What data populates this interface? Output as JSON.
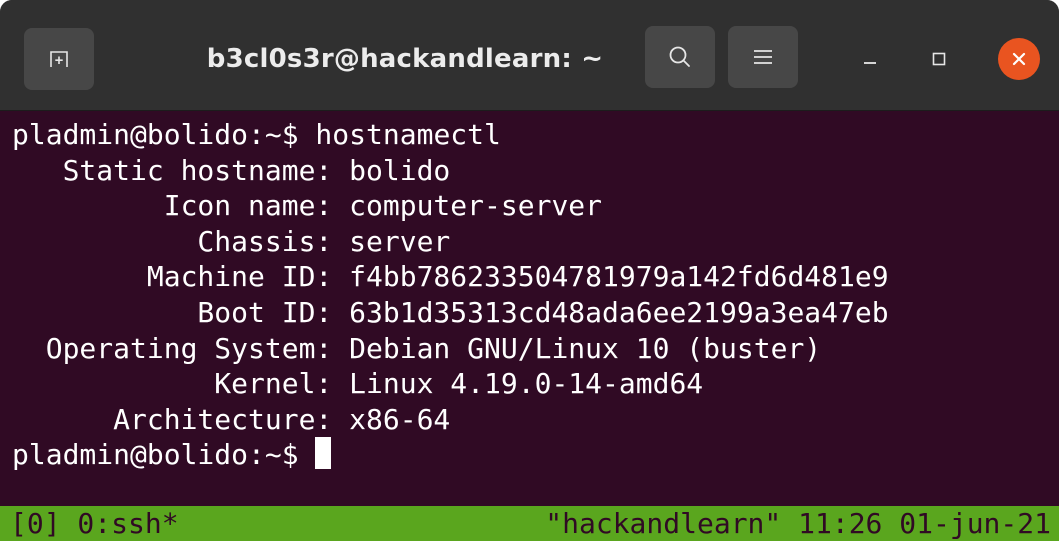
{
  "window": {
    "title": "b3cl0s3r@hackandlearn: ~",
    "icons": {
      "new_tab": "new-tab-icon",
      "search": "search-icon",
      "menu": "hamburger-menu-icon",
      "minimize": "minimize-icon",
      "maximize": "maximize-icon",
      "close": "close-icon"
    },
    "colors": {
      "titlebar": "#303030",
      "button": "#474747",
      "close": "#e95420",
      "terminal_bg": "#300a24",
      "status_bg": "#5aa61e"
    }
  },
  "terminal": {
    "prompt": "pladmin@bolido:~$",
    "command": " hostnamectl",
    "output": [
      "   Static hostname: bolido",
      "         Icon name: computer-server",
      "           Chassis: server",
      "        Machine ID: f4bb786233504781979a142fd6d481e9",
      "           Boot ID: 63b1d35313cd48ada6ee2199a3ea47eb",
      "  Operating System: Debian GNU/Linux 10 (buster)",
      "            Kernel: Linux 4.19.0-14-amd64",
      "      Architecture: x86-64"
    ],
    "final_prompt": "pladmin@bolido:~$ "
  },
  "statusbar": {
    "left": "[0] 0:ssh*",
    "right": "\"hackandlearn\" 11:26 01-jun-21"
  }
}
